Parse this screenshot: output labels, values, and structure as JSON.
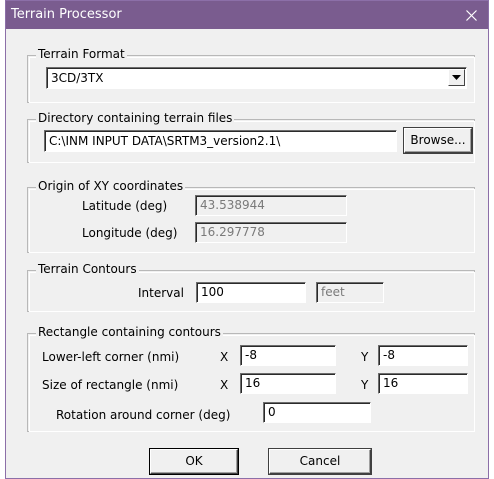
{
  "window": {
    "title": "Terrain Processor"
  },
  "terrain_format": {
    "legend": "Terrain Format",
    "selected": "3CD/3TX"
  },
  "directory": {
    "legend": "Directory containing terrain files",
    "path": "C:\\INM INPUT DATA\\SRTM3_version2.1\\",
    "browse_label": "Browse..."
  },
  "origin": {
    "legend": "Origin of XY coordinates",
    "latitude_label": "Latitude (deg)",
    "latitude_value": "43.538944",
    "longitude_label": "Longitude (deg)",
    "longitude_value": "16.297778"
  },
  "contours": {
    "legend": "Terrain Contours",
    "interval_label": "Interval",
    "interval_value": "100",
    "unit": "feet"
  },
  "rectangle": {
    "legend": "Rectangle containing contours",
    "lower_left_label": "Lower-left corner (nmi)",
    "size_label": "Size of rectangle (nmi)",
    "x_label": "X",
    "y_label": "Y",
    "lower_left_x": "-8",
    "lower_left_y": "-8",
    "size_x": "16",
    "size_y": "16",
    "rotation_label": "Rotation around corner (deg)",
    "rotation_value": "0"
  },
  "buttons": {
    "ok": "OK",
    "cancel": "Cancel"
  }
}
